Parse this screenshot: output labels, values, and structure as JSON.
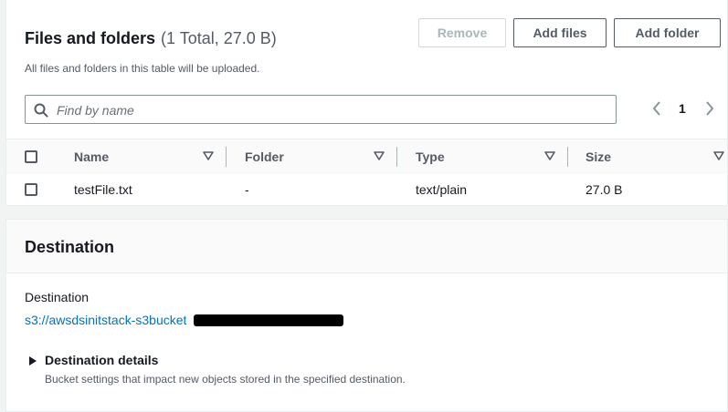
{
  "files_panel": {
    "title": "Files and folders",
    "count": "(1 Total, 27.0 B)",
    "description": "All files and folders in this table will be uploaded.",
    "buttons": {
      "remove": "Remove",
      "add_files": "Add files",
      "add_folder": "Add folder"
    },
    "search": {
      "placeholder": "Find by name",
      "value": ""
    },
    "pagination": {
      "current_page": "1"
    },
    "table": {
      "columns": [
        "Name",
        "Folder",
        "Type",
        "Size"
      ],
      "rows": [
        {
          "name": "testFile.txt",
          "folder": "-",
          "type": "text/plain",
          "size": "27.0 B"
        }
      ]
    }
  },
  "destination_panel": {
    "title": "Destination",
    "label": "Destination",
    "link": "s3://awsdsinitstack-s3bucket",
    "details": {
      "label": "Destination details",
      "description": "Bucket settings that impact new objects stored in the specified destination."
    }
  },
  "colors": {
    "link": "#0073bb",
    "text": "#16191f",
    "secondary": "#545b64",
    "background": "#f2f3f3"
  }
}
